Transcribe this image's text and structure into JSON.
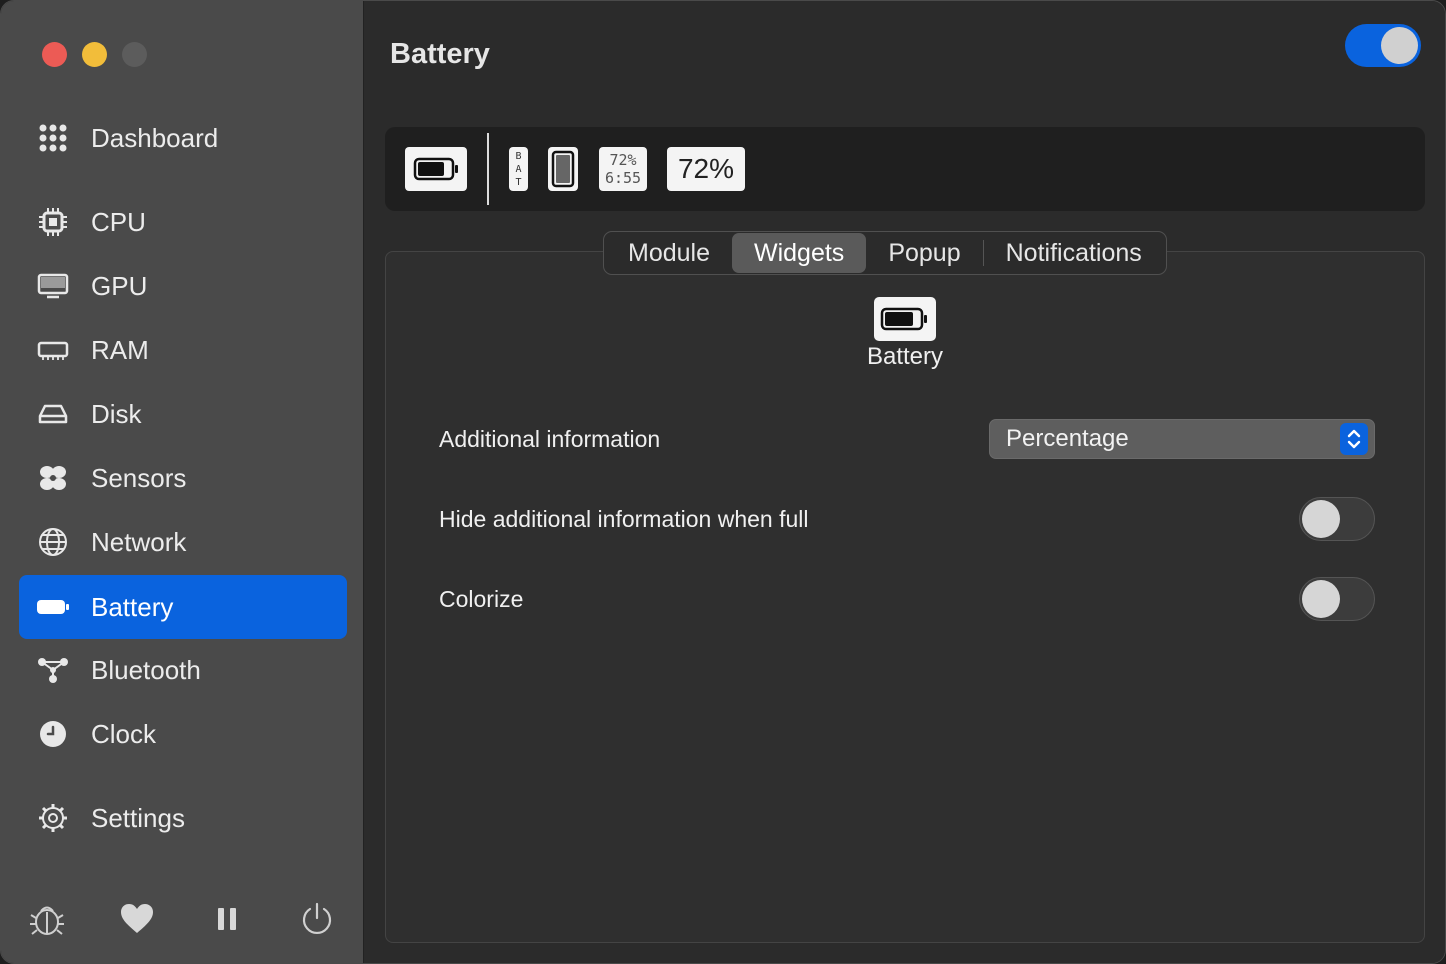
{
  "window": {
    "accent": "#0a63de"
  },
  "sidebar": {
    "items": [
      {
        "label": "Dashboard",
        "icon": "dashboard-grid-icon"
      },
      {
        "label": "CPU",
        "icon": "cpu-chip-icon"
      },
      {
        "label": "GPU",
        "icon": "monitor-icon"
      },
      {
        "label": "RAM",
        "icon": "memory-icon"
      },
      {
        "label": "Disk",
        "icon": "disk-icon"
      },
      {
        "label": "Sensors",
        "icon": "fan-icon"
      },
      {
        "label": "Network",
        "icon": "globe-icon"
      },
      {
        "label": "Battery",
        "icon": "battery-icon",
        "active": true
      },
      {
        "label": "Bluetooth",
        "icon": "bluetooth-network-icon"
      },
      {
        "label": "Clock",
        "icon": "clock-icon"
      },
      {
        "label": "Settings",
        "icon": "gear-icon"
      }
    ],
    "bottom_icons": [
      "bug-icon",
      "heart-icon",
      "pause-icon",
      "power-icon"
    ]
  },
  "main": {
    "title": "Battery",
    "module_enabled": true,
    "widget_strip": {
      "vertical_label": [
        "B",
        "A",
        "T"
      ],
      "mini_text_top": "72%",
      "mini_text_bottom": "6:55",
      "text_widget": "72%"
    },
    "tabs": [
      {
        "label": "Module"
      },
      {
        "label": "Widgets",
        "active": true
      },
      {
        "label": "Popup"
      },
      {
        "label": "Notifications"
      }
    ],
    "widget_name": "Battery",
    "settings": {
      "additional_info_label": "Additional information",
      "additional_info_value": "Percentage",
      "hide_when_full_label": "Hide additional information when full",
      "hide_when_full": false,
      "colorize_label": "Colorize",
      "colorize": false
    }
  }
}
